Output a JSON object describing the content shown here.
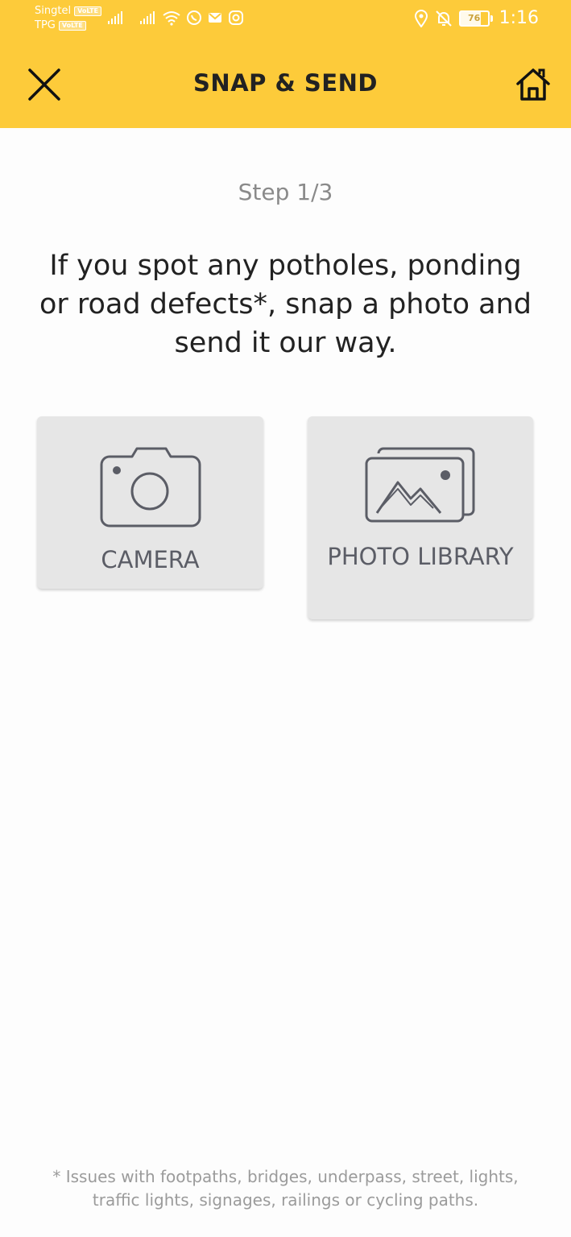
{
  "status_bar": {
    "carrier_1": "Singtel",
    "carrier_2": "TPG",
    "volte_label": "VoLTE",
    "battery_level": "76",
    "battery_fraction": 0.76,
    "time": "1:16"
  },
  "header": {
    "title": "SNAP & SEND",
    "close_icon": "close-icon",
    "home_icon": "home-icon",
    "background_color": "#fdcb3a"
  },
  "main": {
    "step": "Step 1/3",
    "instruction": "If you spot any potholes, ponding or road defects*, snap a photo and send it our way.",
    "options": [
      {
        "label": "CAMERA",
        "icon": "camera-icon"
      },
      {
        "label": "PHOTO LIBRARY",
        "icon": "photo-library-icon"
      }
    ]
  },
  "footnote": "* Issues with footpaths, bridges, underpass, street, lights, traffic lights, signages, railings or cycling paths."
}
